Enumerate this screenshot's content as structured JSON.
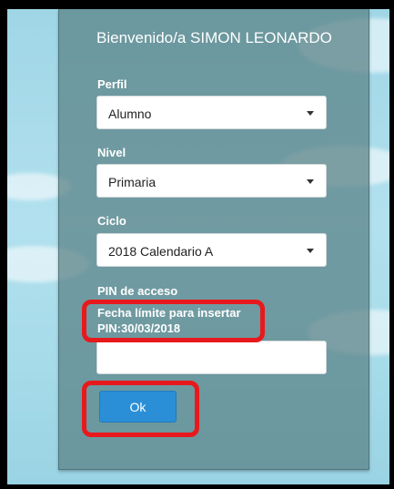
{
  "welcome_text": "Bienvenido/a SIMON LEONARDO",
  "perfil": {
    "label": "Perfil",
    "value": "Alumno"
  },
  "nivel": {
    "label": "Nivel",
    "value": "Primaria"
  },
  "ciclo": {
    "label": "Ciclo",
    "value": "2018 Calendario A"
  },
  "pin": {
    "label": "PIN de acceso",
    "deadline_line1": "Fecha límite para insertar",
    "deadline_line2": "PIN:30/03/2018",
    "value": ""
  },
  "ok_label": "Ok",
  "colors": {
    "panel": "#58807f",
    "button": "#2a8fd6",
    "highlight": "#e8191d",
    "sky": "#a6dbe9"
  },
  "icons": [
    "chevron-down-icon"
  ]
}
